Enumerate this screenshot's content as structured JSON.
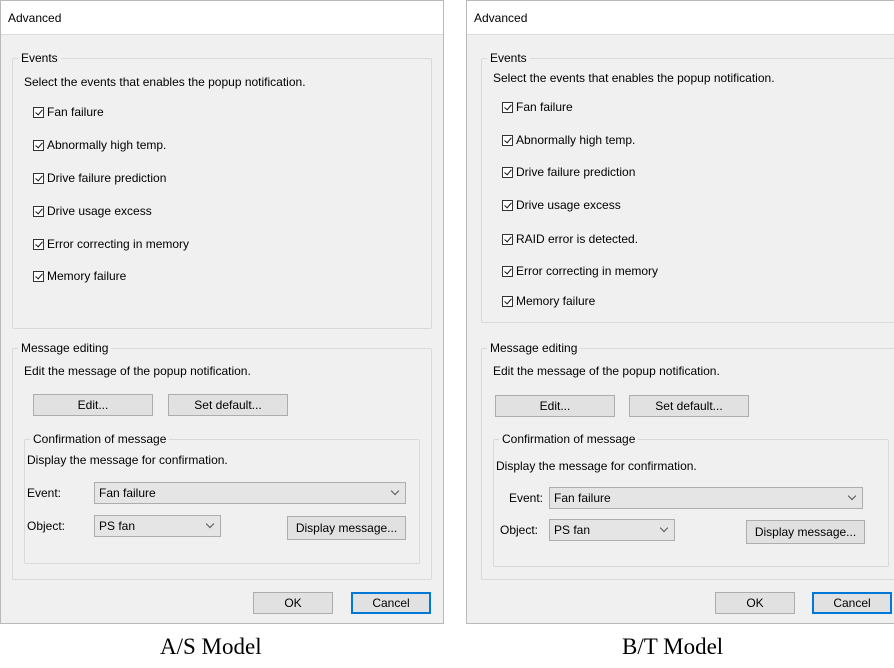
{
  "as_dialog": {
    "title": "Advanced",
    "events": {
      "legend": "Events",
      "description": "Select the events that enables the popup notification.",
      "items": [
        {
          "label": "Fan failure",
          "checked": true
        },
        {
          "label": "Abnormally high temp.",
          "checked": true
        },
        {
          "label": "Drive failure prediction",
          "checked": true
        },
        {
          "label": "Drive usage excess",
          "checked": true
        },
        {
          "label": "Error correcting in memory",
          "checked": true
        },
        {
          "label": "Memory failure",
          "checked": true
        }
      ]
    },
    "message_editing": {
      "legend": "Message editing",
      "description": "Edit the message of the popup notification.",
      "edit_label": "Edit...",
      "set_default_label": "Set default...",
      "confirmation": {
        "legend": "Confirmation of message",
        "description": "Display the message for confirmation.",
        "event_label": "Event:",
        "event_value": "Fan failure",
        "object_label": "Object:",
        "object_value": "PS fan",
        "display_label": "Display message..."
      }
    },
    "ok_label": "OK",
    "cancel_label": "Cancel"
  },
  "bt_dialog": {
    "title": "Advanced",
    "events": {
      "legend": "Events",
      "description": "Select the events that enables the popup notification.",
      "items": [
        {
          "label": "Fan failure",
          "checked": true
        },
        {
          "label": "Abnormally high temp.",
          "checked": true
        },
        {
          "label": "Drive failure prediction",
          "checked": true
        },
        {
          "label": "Drive usage excess",
          "checked": true
        },
        {
          "label": "RAID error is detected.",
          "checked": true
        },
        {
          "label": "Error correcting in memory",
          "checked": true
        },
        {
          "label": "Memory failure",
          "checked": true
        }
      ]
    },
    "message_editing": {
      "legend": "Message editing",
      "description": "Edit the message of the popup notification.",
      "edit_label": "Edit...",
      "set_default_label": "Set default...",
      "confirmation": {
        "legend": "Confirmation of message",
        "description": "Display the message for confirmation.",
        "event_label": "Event:",
        "event_value": "Fan failure",
        "object_label": "Object:",
        "object_value": "PS fan",
        "display_label": "Display message..."
      }
    },
    "ok_label": "OK",
    "cancel_label": "Cancel"
  },
  "captions": {
    "as": "A/S Model",
    "bt": "B/T Model"
  }
}
